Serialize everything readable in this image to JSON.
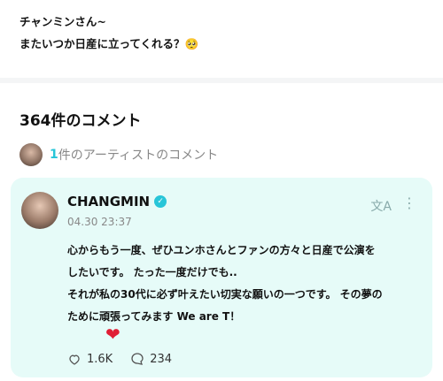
{
  "post": {
    "line1": "チャンミンさん~",
    "line2": "またいつか日産に立ってくれる？🥺"
  },
  "comments": {
    "count_title": "364件のコメント",
    "artist_count_num": "1",
    "artist_count_text": "件のアーティストのコメント"
  },
  "comment": {
    "author": "CHANGMIN",
    "date": "04.30 23:37",
    "line1": "心からもう一度、ぜひユンホさんとファンの方々と日産で公演を",
    "line2": "したいです。 たった一度だけでも..",
    "line3": "それが私の30代に必ず叶えたい切実な願いの一つです。 その夢の",
    "line4": "ために頑張ってみます We are T！",
    "heart": "❤",
    "likes": "1.6K",
    "replies": "234"
  },
  "icons": {
    "verified": "verified-badge-icon",
    "translate": "translate-icon",
    "more": "more-vertical-icon",
    "like": "like-icon",
    "reply": "reply-icon"
  },
  "colors": {
    "accent": "#27c5d8",
    "card_bg": "#e6fbf8",
    "heart": "#e01e35"
  }
}
